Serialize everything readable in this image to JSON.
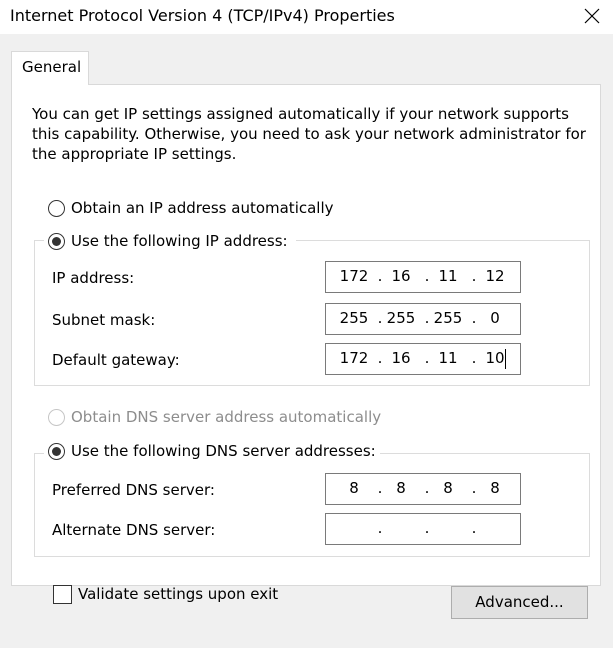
{
  "window": {
    "title": "Internet Protocol Version 4 (TCP/IPv4) Properties"
  },
  "tabs": [
    {
      "label": "General",
      "selected": true
    }
  ],
  "general": {
    "description": "You can get IP settings assigned automatically if your network supports this capability. Otherwise, you need to ask your network administrator for the appropriate IP settings.",
    "ip_auto": {
      "label": "Obtain an IP address automatically",
      "checked": false
    },
    "ip_manual": {
      "label": "Use the following IP address:",
      "checked": true
    },
    "ip_address": {
      "label": "IP address:",
      "octets": [
        "172",
        "16",
        "11",
        "12"
      ]
    },
    "subnet_mask": {
      "label": "Subnet mask:",
      "octets": [
        "255",
        "255",
        "255",
        "0"
      ]
    },
    "default_gateway": {
      "label": "Default gateway:",
      "octets": [
        "172",
        "16",
        "11",
        "10"
      ]
    },
    "dns_auto": {
      "label": "Obtain DNS server address automatically",
      "checked": false,
      "disabled": true
    },
    "dns_manual": {
      "label": "Use the following DNS server addresses:",
      "checked": true
    },
    "preferred_dns": {
      "label": "Preferred DNS server:",
      "octets": [
        "8",
        "8",
        "8",
        "8"
      ]
    },
    "alternate_dns": {
      "label": "Alternate DNS server:",
      "octets": [
        "",
        "",
        "",
        ""
      ]
    },
    "validate": {
      "label": "Validate settings upon exit",
      "checked": false
    },
    "advanced_button": "Advanced..."
  },
  "icons": {
    "close": "close-icon"
  }
}
